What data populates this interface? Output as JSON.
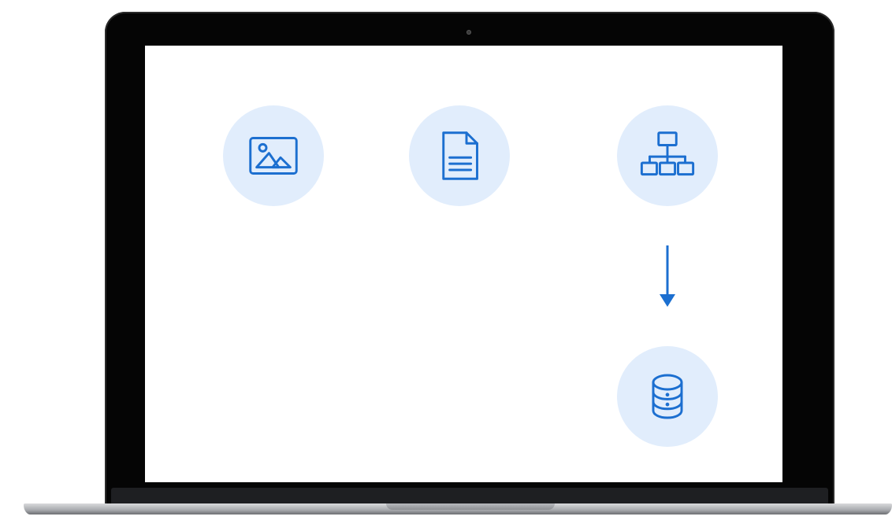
{
  "illustration": {
    "accent_color": "#1c6fd0",
    "circle_color": "#e1edfc",
    "icons": [
      {
        "name": "image-icon"
      },
      {
        "name": "document-icon"
      },
      {
        "name": "hierarchy-icon"
      },
      {
        "name": "database-icon"
      }
    ],
    "connector": "arrow-down-icon"
  }
}
